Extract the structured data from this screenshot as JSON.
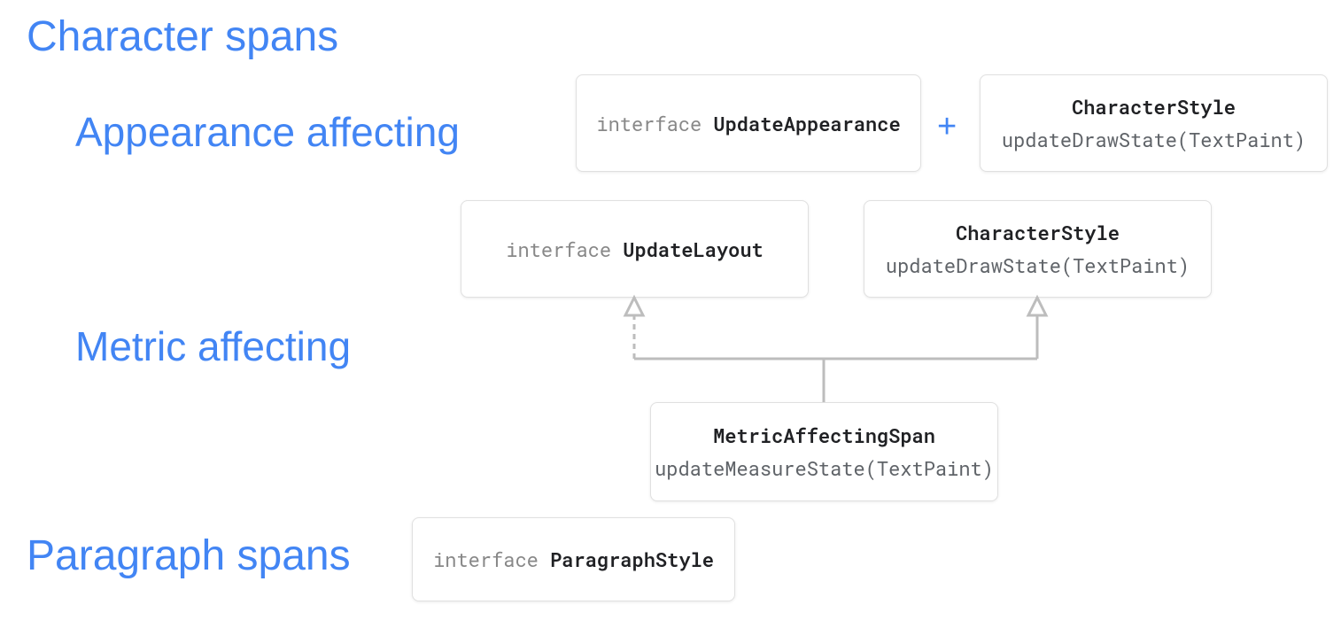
{
  "headings": {
    "character_spans": "Character spans",
    "appearance_affecting": "Appearance affecting",
    "metric_affecting": "Metric affecting",
    "paragraph_spans": "Paragraph spans"
  },
  "boxes": {
    "update_appearance": {
      "keyword": "interface",
      "name": "UpdateAppearance"
    },
    "character_style_1": {
      "title": "CharacterStyle",
      "method": "updateDrawState(TextPaint)"
    },
    "update_layout": {
      "keyword": "interface",
      "name": "UpdateLayout"
    },
    "character_style_2": {
      "title": "CharacterStyle",
      "method": "updateDrawState(TextPaint)"
    },
    "metric_affecting_span": {
      "title": "MetricAffectingSpan",
      "method": "updateMeasureState(TextPaint)"
    },
    "paragraph_style": {
      "keyword": "interface",
      "name": "ParagraphStyle"
    }
  },
  "plus": "+"
}
